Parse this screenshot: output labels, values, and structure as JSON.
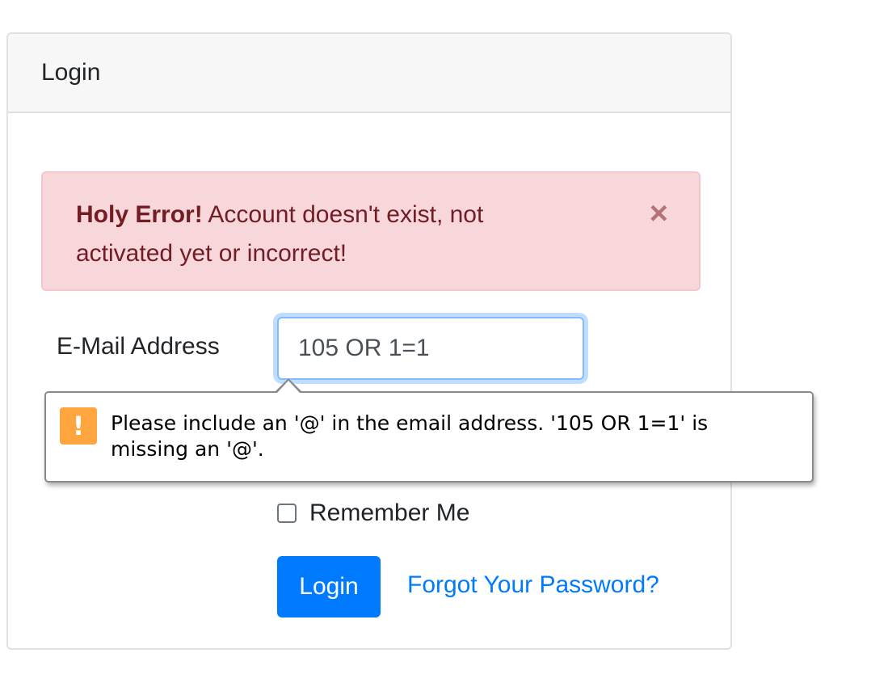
{
  "card": {
    "header_title": "Login"
  },
  "alert": {
    "strong": "Holy Error!",
    "message": "Account doesn't exist, not activated yet or incorrect!",
    "close_glyph": "×"
  },
  "form": {
    "email_label": "E-Mail Address",
    "email_value": "105 OR 1=1",
    "remember_label": "Remember Me",
    "remember_checked": false,
    "login_button": "Login",
    "forgot_link": "Forgot Your Password?"
  },
  "tooltip": {
    "icon": "warning-icon",
    "icon_glyph": "!",
    "message": "Please include an '@' in the email address. '105 OR 1=1' is missing an '@'."
  },
  "colors": {
    "primary": "#007bff",
    "alert_bg": "#f8d7da",
    "alert_text": "#721c24",
    "warning_icon": "#ffa53d"
  }
}
